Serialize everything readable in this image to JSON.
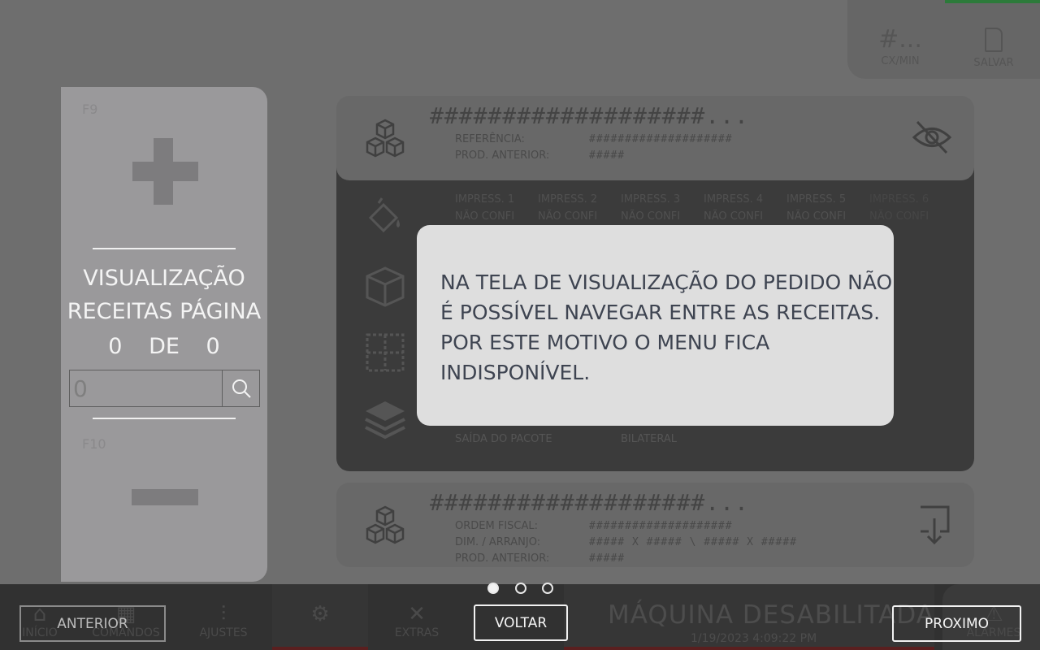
{
  "top_right": {
    "counter_value": "#...",
    "counter_label": "CX/MIN",
    "save_label": "SALVAR"
  },
  "order_card": {
    "title": "###################...",
    "rows": [
      {
        "label": "REFERÊNCIA:",
        "value": "####################"
      },
      {
        "label": "PROD. ANTERIOR:",
        "value": "#####"
      }
    ]
  },
  "printing": {
    "items": [
      {
        "label": "IMPRESS. 1",
        "status": "NÃO CONFI"
      },
      {
        "label": "IMPRESS. 2",
        "status": "NÃO CONFI"
      },
      {
        "label": "IMPRESS. 3",
        "status": "NÃO CONFI"
      },
      {
        "label": "IMPRESS. 4",
        "status": "NÃO CONFI"
      },
      {
        "label": "IMPRESS. 5",
        "status": "NÃO CONFI"
      },
      {
        "label": "IMPRESS. 6",
        "status": "NÃO CONFI"
      }
    ],
    "exit_label": "SAÍDA DO PACOTE",
    "exit_value": "BILATERAL"
  },
  "next_card": {
    "title": "###################...",
    "rows": [
      {
        "label": "ORDEM FISCAL:",
        "value": "####################"
      },
      {
        "label": "DIM. / ARRANJO:",
        "value": "##### X ##### \\ ##### X #####"
      },
      {
        "label": "PROD. ANTERIOR:",
        "value": "#####"
      }
    ]
  },
  "nav": {
    "inicio": "INÍCIO",
    "comandos": "COMANDOS",
    "ajustes": "AJUSTES",
    "extras": "EXTRAS",
    "alarmes": "ALARMES"
  },
  "machine_status": {
    "text": "MÁQUINA DESABILITADA",
    "datetime": "1/19/2023 4:09:22 PM"
  },
  "recipes_panel": {
    "key_up": "F9",
    "key_down": "F10",
    "title_line1": "VISUALIZAÇÃO",
    "title_line2": "RECEITAS PÁGINA",
    "page_current": "0",
    "page_sep": "DE",
    "page_total": "0",
    "search_value": "0"
  },
  "tooltip": {
    "lines": [
      "NA TELA DE VISUALIZAÇÃO DO PEDIDO NÃO",
      "É POSSÍVEL NAVEGAR ENTRE AS RECEITAS.",
      "POR ESTE MOTIVO O MENU FICA",
      "INDISPONÍVEL."
    ]
  },
  "tour": {
    "prev_label": "ANTERIOR",
    "back_label": "VOLTAR",
    "next_label": "PROXIMO",
    "step_count": 3,
    "active_step": 1
  }
}
